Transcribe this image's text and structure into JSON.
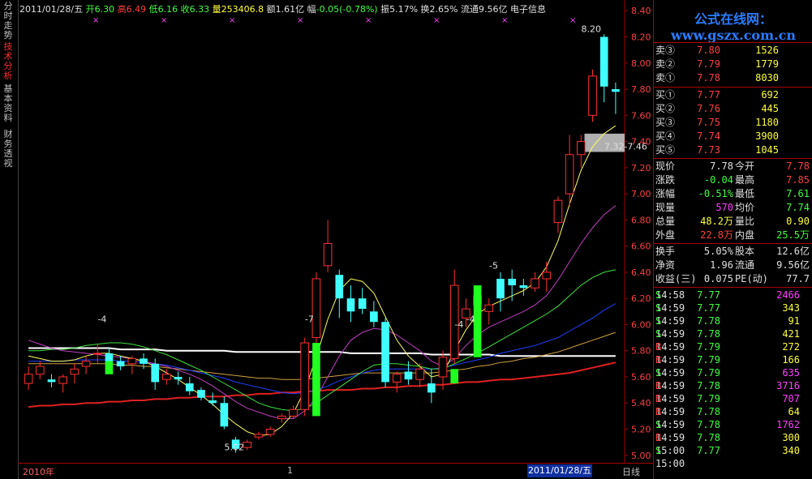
{
  "left_tabs": [
    {
      "label": "分时走势",
      "active": false
    },
    {
      "label": "技术分析",
      "active": true
    },
    {
      "label": "基本资料",
      "active": false
    },
    {
      "label": "财务透视",
      "active": false
    }
  ],
  "header": {
    "date": "2011/01/28/五",
    "open_label": "开",
    "open_value": "6.30",
    "high_label": "高",
    "high_value": "6.49",
    "low_label": "低",
    "low_value": "6.16",
    "close_label": "收",
    "close_value": "6.33",
    "vol_label": "量",
    "vol_value": "253406.8",
    "amount_label": "额",
    "amount_value": "1.61亿",
    "change_label": "幅",
    "change_value": "-0.05(-0.78%)",
    "amplitude_label": "振",
    "amplitude_value": "5.17%",
    "turnover_label": "换",
    "turnover_value": "2.65%",
    "float_label": "流通",
    "float_value": "9.56亿",
    "sector": "电子信息"
  },
  "logo": {
    "text": "公式在线网：www.gszx.com.cn"
  },
  "order_book": {
    "asks": [
      {
        "label": "卖③",
        "price": "7.80",
        "volume": "1526"
      },
      {
        "label": "卖②",
        "price": "7.79",
        "volume": "1779"
      },
      {
        "label": "卖①",
        "price": "7.78",
        "volume": "8030"
      }
    ],
    "bids": [
      {
        "label": "买①",
        "price": "7.77",
        "volume": "692"
      },
      {
        "label": "买②",
        "price": "7.76",
        "volume": "445"
      },
      {
        "label": "买③",
        "price": "7.75",
        "volume": "1180"
      },
      {
        "label": "买④",
        "price": "7.74",
        "volume": "3900"
      },
      {
        "label": "买⑤",
        "price": "7.73",
        "volume": "1045"
      }
    ]
  },
  "quote_stats": [
    {
      "l1": "现价",
      "v1": "7.78",
      "c1": "white",
      "l2": "今开",
      "v2": "7.78",
      "c2": "red"
    },
    {
      "l1": "涨跌",
      "v1": "-0.04",
      "c1": "green",
      "l2": "最高",
      "v2": "7.85",
      "c2": "red"
    },
    {
      "l1": "涨幅",
      "v1": "-0.51%",
      "c1": "green",
      "l2": "最低",
      "v2": "7.61",
      "c2": "green"
    },
    {
      "l1": "现量",
      "v1": "570",
      "c1": "magenta",
      "l2": "均价",
      "v2": "7.74",
      "c2": "green"
    },
    {
      "l1": "总量",
      "v1": "48.2万",
      "c1": "yellow",
      "l2": "量比",
      "v2": "0.90",
      "c2": "yellow"
    },
    {
      "l1": "外盘",
      "v1": "22.8万",
      "c1": "red",
      "l2": "内盘",
      "v2": "25.5万",
      "c2": "green"
    }
  ],
  "fundamentals": [
    {
      "l1": "换手",
      "v1": "5.05%",
      "l2": "股本",
      "v2": "12.6亿"
    },
    {
      "l1": "净资",
      "v1": "1.96",
      "l2": "流通",
      "v2": "9.56亿"
    },
    {
      "l1": "收益(三)",
      "v1": "0.075",
      "l2": "PE(动)",
      "v2": "77.7"
    }
  ],
  "ticks": [
    {
      "time": "14:58",
      "price": "7.77",
      "vol": "2466",
      "side": "S",
      "vcolor": "magenta"
    },
    {
      "time": "14:59",
      "price": "7.77",
      "vol": "343",
      "side": "S",
      "vcolor": "yellow"
    },
    {
      "time": "14:59",
      "price": "7.78",
      "vol": "91",
      "side": "S",
      "vcolor": "yellow"
    },
    {
      "time": "14:59",
      "price": "7.78",
      "vol": "421",
      "side": "S",
      "vcolor": "yellow"
    },
    {
      "time": "14:59",
      "price": "7.79",
      "vol": "272",
      "side": "B",
      "vcolor": "yellow"
    },
    {
      "time": "14:59",
      "price": "7.79",
      "vol": "166",
      "side": "B",
      "vcolor": "yellow"
    },
    {
      "time": "14:59",
      "price": "7.79",
      "vol": "635",
      "side": "S",
      "vcolor": "magenta"
    },
    {
      "time": "14:59",
      "price": "7.78",
      "vol": "3716",
      "side": "B",
      "vcolor": "magenta"
    },
    {
      "time": "14:59",
      "price": "7.79",
      "vol": "707",
      "side": "B",
      "vcolor": "magenta"
    },
    {
      "time": "14:59",
      "price": "7.78",
      "vol": "64",
      "side": "B",
      "vcolor": "yellow"
    },
    {
      "time": "14:59",
      "price": "7.78",
      "vol": "1762",
      "side": "S",
      "vcolor": "magenta"
    },
    {
      "time": "14:59",
      "price": "7.78",
      "vol": "300",
      "side": "B",
      "vcolor": "yellow"
    },
    {
      "time": "15:00",
      "price": "7.77",
      "vol": "340",
      "side": "S",
      "vcolor": "yellow"
    },
    {
      "time": "15:00",
      "price": "",
      "vol": "",
      "side": "",
      "vcolor": "yellow"
    }
  ],
  "bottom": {
    "year_label": "2010年",
    "month_label": "1",
    "cursor_date": "2011/01/28/五",
    "period": "日线"
  },
  "colors": {
    "up": "#ff3030",
    "down": "#40ffff",
    "axis": "#a00000",
    "ma_white": "#ffffff",
    "ma_yellow": "#ffff60",
    "ma_green": "#40e040",
    "ma_magenta": "#c040c0",
    "ma_blue": "#2040ff",
    "ma_orange": "#d0a040",
    "ma_red": "#e02020",
    "signal_green": "#20ff20"
  },
  "chart_data": {
    "type": "candlestick",
    "y_ticks": [
      "8.40",
      "8.20",
      "8.00",
      "7.80",
      "7.60",
      "7.40",
      "7.20",
      "7.00",
      "6.80",
      "6.60",
      "6.40",
      "6.20",
      "6.00",
      "5.80",
      "5.60",
      "5.40",
      "5.20",
      "5.00"
    ],
    "ylim": [
      4.98,
      8.42
    ],
    "candles": [
      [
        5.55,
        5.68,
        5.5,
        5.62
      ],
      [
        5.62,
        5.72,
        5.58,
        5.68
      ],
      [
        5.58,
        5.62,
        5.52,
        5.56
      ],
      [
        5.55,
        5.62,
        5.48,
        5.6
      ],
      [
        5.62,
        5.7,
        5.55,
        5.66
      ],
      [
        5.68,
        5.76,
        5.62,
        5.72
      ],
      [
        5.78,
        5.85,
        5.7,
        5.78
      ],
      [
        5.78,
        5.82,
        5.68,
        5.72
      ],
      [
        5.72,
        5.76,
        5.65,
        5.68
      ],
      [
        5.7,
        5.76,
        5.62,
        5.74
      ],
      [
        5.74,
        5.78,
        5.66,
        5.7
      ],
      [
        5.7,
        5.74,
        5.5,
        5.56
      ],
      [
        5.58,
        5.66,
        5.54,
        5.62
      ],
      [
        5.6,
        5.64,
        5.54,
        5.58
      ],
      [
        5.55,
        5.6,
        5.46,
        5.49
      ],
      [
        5.5,
        5.52,
        5.42,
        5.44
      ],
      [
        5.42,
        5.48,
        5.38,
        5.4
      ],
      [
        5.4,
        5.45,
        5.2,
        5.22
      ],
      [
        5.12,
        5.14,
        5.02,
        5.05
      ],
      [
        5.06,
        5.12,
        5.04,
        5.1
      ],
      [
        5.14,
        5.18,
        5.12,
        5.16
      ],
      [
        5.16,
        5.22,
        5.14,
        5.2
      ],
      [
        5.28,
        5.32,
        5.25,
        5.3
      ],
      [
        5.3,
        5.38,
        5.28,
        5.35
      ],
      [
        5.35,
        5.9,
        5.3,
        5.86
      ],
      [
        5.9,
        6.4,
        5.86,
        6.35
      ],
      [
        6.45,
        6.8,
        6.4,
        6.62
      ],
      [
        6.38,
        6.42,
        6.05,
        6.2
      ],
      [
        6.2,
        6.3,
        6.02,
        6.1
      ],
      [
        6.2,
        6.28,
        6.08,
        6.12
      ],
      [
        6.1,
        6.18,
        5.98,
        6.02
      ],
      [
        6.02,
        6.05,
        5.52,
        5.56
      ],
      [
        5.56,
        5.64,
        5.48,
        5.62
      ],
      [
        5.64,
        5.72,
        5.54,
        5.58
      ],
      [
        5.58,
        5.7,
        5.52,
        5.66
      ],
      [
        5.55,
        5.66,
        5.4,
        5.48
      ],
      [
        5.6,
        5.8,
        5.5,
        5.75
      ],
      [
        5.74,
        6.42,
        5.7,
        6.3
      ],
      [
        6.05,
        6.2,
        5.98,
        6.12
      ],
      [
        6.15,
        6.25,
        6.05,
        6.22
      ],
      [
        6.1,
        6.2,
        6.0,
        6.15
      ],
      [
        6.35,
        6.4,
        6.1,
        6.2
      ],
      [
        6.35,
        6.42,
        6.18,
        6.3
      ],
      [
        6.3,
        6.35,
        6.22,
        6.28
      ],
      [
        6.28,
        6.4,
        6.25,
        6.35
      ],
      [
        6.35,
        6.48,
        6.25,
        6.4
      ],
      [
        6.78,
        6.98,
        6.7,
        6.95
      ],
      [
        7.0,
        7.45,
        6.9,
        7.3
      ],
      [
        7.3,
        7.45,
        7.2,
        7.4
      ],
      [
        7.6,
        7.95,
        7.55,
        7.9
      ],
      [
        8.2,
        8.22,
        7.7,
        7.82
      ],
      [
        7.8,
        7.85,
        7.61,
        7.78
      ]
    ],
    "signals": [
      {
        "index": 7,
        "low": 5.62,
        "high": 5.72
      },
      {
        "index": 25,
        "low": 5.3,
        "high": 5.86
      },
      {
        "index": 37,
        "low": 5.55,
        "high": 5.66
      },
      {
        "index": 39,
        "low": 5.75,
        "high": 6.3
      }
    ],
    "annotations": [
      {
        "text": "-4",
        "index": 7,
        "price": 6.0
      },
      {
        "text": "-7",
        "index": 25,
        "price": 6.0
      },
      {
        "text": "-4",
        "index": 38,
        "price": 5.96
      },
      {
        "text": "-5",
        "index": 41,
        "price": 6.41
      },
      {
        "text": "-4",
        "index": 39,
        "price": 6.0
      },
      {
        "text": "5.02",
        "index": 18,
        "price": 5.02
      },
      {
        "text": "8.20",
        "index": 49,
        "price": 8.22
      },
      {
        "text": "7.32-7.46",
        "index": 51,
        "price": 7.32
      }
    ],
    "band": {
      "low": 7.32,
      "high": 7.46
    },
    "ma_lines": [
      {
        "color": "ma_white",
        "values": [
          5.82,
          5.82,
          5.82,
          5.82,
          5.82,
          5.82,
          5.82,
          5.82,
          5.81,
          5.81,
          5.81,
          5.81,
          5.8,
          5.8,
          5.8,
          5.8,
          5.8,
          5.8,
          5.79,
          5.79,
          5.79,
          5.79,
          5.79,
          5.79,
          5.79,
          5.79,
          5.79,
          5.79,
          5.78,
          5.78,
          5.78,
          5.78,
          5.78,
          5.78,
          5.78,
          5.77,
          5.77,
          5.77,
          5.77,
          5.77,
          5.77,
          5.76,
          5.76,
          5.76,
          5.76,
          5.76,
          5.76,
          5.76,
          5.76,
          5.76,
          5.76,
          5.76
        ]
      },
      {
        "color": "ma_red",
        "values": [
          5.37,
          5.38,
          5.38,
          5.39,
          5.39,
          5.4,
          5.4,
          5.41,
          5.41,
          5.42,
          5.42,
          5.43,
          5.43,
          5.44,
          5.44,
          5.45,
          5.45,
          5.45,
          5.46,
          5.46,
          5.47,
          5.47,
          5.48,
          5.48,
          5.49,
          5.49,
          5.5,
          5.5,
          5.5,
          5.51,
          5.51,
          5.52,
          5.52,
          5.53,
          5.53,
          5.54,
          5.54,
          5.55,
          5.56,
          5.56,
          5.57,
          5.58,
          5.58,
          5.59,
          5.6,
          5.61,
          5.62,
          5.63,
          5.65,
          5.67,
          5.69,
          5.71
        ]
      },
      {
        "color": "ma_orange",
        "values": [
          5.7,
          5.7,
          5.7,
          5.7,
          5.7,
          5.7,
          5.7,
          5.7,
          5.69,
          5.69,
          5.68,
          5.68,
          5.67,
          5.66,
          5.65,
          5.64,
          5.63,
          5.62,
          5.61,
          5.6,
          5.59,
          5.59,
          5.58,
          5.58,
          5.58,
          5.59,
          5.6,
          5.61,
          5.62,
          5.63,
          5.63,
          5.63,
          5.63,
          5.63,
          5.63,
          5.63,
          5.64,
          5.65,
          5.66,
          5.68,
          5.69,
          5.71,
          5.72,
          5.74,
          5.75,
          5.77,
          5.79,
          5.82,
          5.85,
          5.88,
          5.91,
          5.94
        ]
      },
      {
        "color": "ma_blue",
        "values": [
          5.72,
          5.72,
          5.72,
          5.72,
          5.73,
          5.73,
          5.73,
          5.73,
          5.72,
          5.72,
          5.71,
          5.7,
          5.69,
          5.67,
          5.65,
          5.63,
          5.61,
          5.59,
          5.56,
          5.54,
          5.52,
          5.5,
          5.48,
          5.47,
          5.48,
          5.5,
          5.53,
          5.57,
          5.6,
          5.63,
          5.65,
          5.66,
          5.66,
          5.66,
          5.66,
          5.66,
          5.67,
          5.69,
          5.71,
          5.73,
          5.75,
          5.78,
          5.8,
          5.82,
          5.84,
          5.87,
          5.9,
          5.95,
          6.0,
          6.05,
          6.11,
          6.16
        ]
      },
      {
        "color": "ma_green",
        "values": [
          5.8,
          5.8,
          5.81,
          5.81,
          5.82,
          5.84,
          5.85,
          5.86,
          5.86,
          5.85,
          5.83,
          5.8,
          5.77,
          5.73,
          5.69,
          5.65,
          5.6,
          5.55,
          5.5,
          5.45,
          5.4,
          5.37,
          5.35,
          5.34,
          5.36,
          5.4,
          5.46,
          5.52,
          5.58,
          5.64,
          5.69,
          5.7,
          5.7,
          5.69,
          5.68,
          5.66,
          5.66,
          5.7,
          5.74,
          5.78,
          5.83,
          5.88,
          5.93,
          5.98,
          6.03,
          6.08,
          6.14,
          6.22,
          6.3,
          6.36,
          6.4,
          6.42
        ]
      },
      {
        "color": "ma_magenta",
        "values": [
          5.88,
          5.85,
          5.82,
          5.8,
          5.79,
          5.78,
          5.77,
          5.76,
          5.75,
          5.74,
          5.72,
          5.7,
          5.68,
          5.65,
          5.62,
          5.58,
          5.53,
          5.47,
          5.41,
          5.36,
          5.33,
          5.3,
          5.28,
          5.28,
          5.34,
          5.44,
          5.6,
          5.76,
          5.88,
          5.94,
          5.97,
          5.96,
          5.92,
          5.86,
          5.8,
          5.72,
          5.68,
          5.74,
          5.84,
          5.92,
          5.98,
          6.02,
          6.06,
          6.1,
          6.15,
          6.22,
          6.34,
          6.48,
          6.62,
          6.74,
          6.84,
          6.91
        ]
      },
      {
        "color": "ma_yellow",
        "values": [
          5.76,
          5.74,
          5.72,
          5.72,
          5.73,
          5.76,
          5.78,
          5.78,
          5.76,
          5.74,
          5.72,
          5.68,
          5.63,
          5.58,
          5.52,
          5.46,
          5.39,
          5.31,
          5.24,
          5.18,
          5.15,
          5.16,
          5.22,
          5.32,
          5.5,
          5.75,
          6.04,
          6.26,
          6.35,
          6.33,
          6.24,
          6.06,
          5.88,
          5.76,
          5.68,
          5.6,
          5.62,
          5.8,
          5.96,
          6.08,
          6.14,
          6.18,
          6.22,
          6.26,
          6.32,
          6.44,
          6.64,
          6.92,
          7.18,
          7.36,
          7.46,
          7.52
        ]
      }
    ]
  }
}
